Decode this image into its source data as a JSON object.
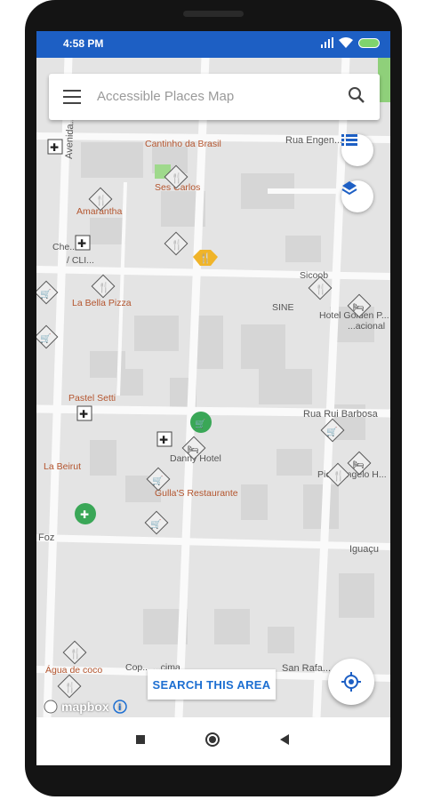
{
  "status_bar": {
    "time": "4:58 PM"
  },
  "search": {
    "placeholder": "Accessible Places Map"
  },
  "map": {
    "places": [
      "Cantinho da Brasil",
      "Ses Carlos",
      "Amarantha",
      "La Bella Pizza",
      "Pastel Setti",
      "Danny Hotel",
      "Gulla'S Restaurante",
      "Água de coco",
      "SINE",
      "Hotel Golden P...",
      "La Beirut",
      "Sicoob"
    ],
    "roads": [
      "Rua Engen...",
      "Rua Rui Barbosa",
      "Avenida...",
      "Iguaçu",
      "San Rafa...",
      "Foz"
    ],
    "partial_labels": [
      "Che...",
      "/ CLI...",
      "Pic... Angelo H...",
      "...acional",
      "Cop... ...cima"
    ]
  },
  "actions": {
    "search_area": "SEARCH THIS AREA"
  },
  "attribution": {
    "brand": "mapbox"
  },
  "colors": {
    "primary": "#1d5fc4",
    "accent": "#1d6fd1",
    "place_label": "#b4552e",
    "green_marker": "#3aa757",
    "yellow_marker": "#f0b429"
  }
}
